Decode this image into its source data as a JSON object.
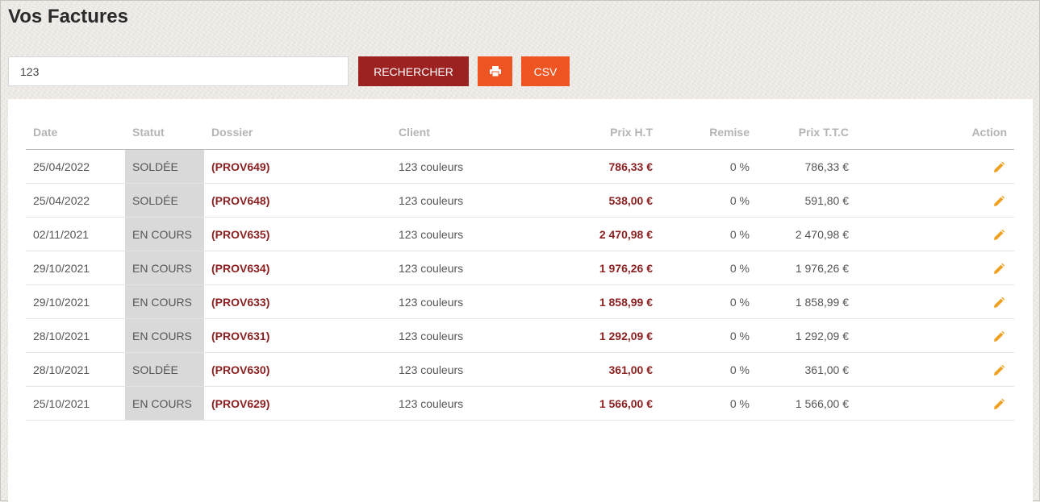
{
  "page": {
    "title": "Vos Factures"
  },
  "search": {
    "value": "123",
    "button_label": "RECHERCHER"
  },
  "toolbar": {
    "print_icon": "print-icon",
    "csv_label": "CSV"
  },
  "colors": {
    "search_button": "#9c2222",
    "action_button": "#ee5522",
    "amount": "#8b1f1f",
    "edit_icon": "#f0a020",
    "statut_bg": "#d9d9d9"
  },
  "table": {
    "headers": [
      "Date",
      "Statut",
      "Dossier",
      "Client",
      "Prix H.T",
      "Remise",
      "Prix T.T.C",
      "Action"
    ],
    "rows": [
      {
        "date": "25/04/2022",
        "statut": "SOLDÉE",
        "dossier": "(PROV649)",
        "client": "123 couleurs",
        "prix_ht": "786,33 €",
        "remise": "0 %",
        "prix_ttc": "786,33 €",
        "action_icon": "edit-icon"
      },
      {
        "date": "25/04/2022",
        "statut": "SOLDÉE",
        "dossier": "(PROV648)",
        "client": "123 couleurs",
        "prix_ht": "538,00 €",
        "remise": "0 %",
        "prix_ttc": "591,80 €",
        "action_icon": "edit-icon"
      },
      {
        "date": "02/11/2021",
        "statut": "EN COURS",
        "dossier": "(PROV635)",
        "client": "123 couleurs",
        "prix_ht": "2 470,98 €",
        "remise": "0 %",
        "prix_ttc": "2 470,98 €",
        "action_icon": "edit-icon"
      },
      {
        "date": "29/10/2021",
        "statut": "EN COURS",
        "dossier": "(PROV634)",
        "client": "123 couleurs",
        "prix_ht": "1 976,26 €",
        "remise": "0 %",
        "prix_ttc": "1 976,26 €",
        "action_icon": "edit-icon"
      },
      {
        "date": "29/10/2021",
        "statut": "EN COURS",
        "dossier": "(PROV633)",
        "client": "123 couleurs",
        "prix_ht": "1 858,99 €",
        "remise": "0 %",
        "prix_ttc": "1 858,99 €",
        "action_icon": "edit-icon"
      },
      {
        "date": "28/10/2021",
        "statut": "EN COURS",
        "dossier": "(PROV631)",
        "client": "123 couleurs",
        "prix_ht": "1 292,09 €",
        "remise": "0 %",
        "prix_ttc": "1 292,09 €",
        "action_icon": "edit-icon"
      },
      {
        "date": "28/10/2021",
        "statut": "SOLDÉE",
        "dossier": "(PROV630)",
        "client": "123 couleurs",
        "prix_ht": "361,00 €",
        "remise": "0 %",
        "prix_ttc": "361,00 €",
        "action_icon": "edit-icon"
      },
      {
        "date": "25/10/2021",
        "statut": "EN COURS",
        "dossier": "(PROV629)",
        "client": "123 couleurs",
        "prix_ht": "1 566,00 €",
        "remise": "0 %",
        "prix_ttc": "1 566,00 €",
        "action_icon": "edit-icon"
      }
    ]
  }
}
